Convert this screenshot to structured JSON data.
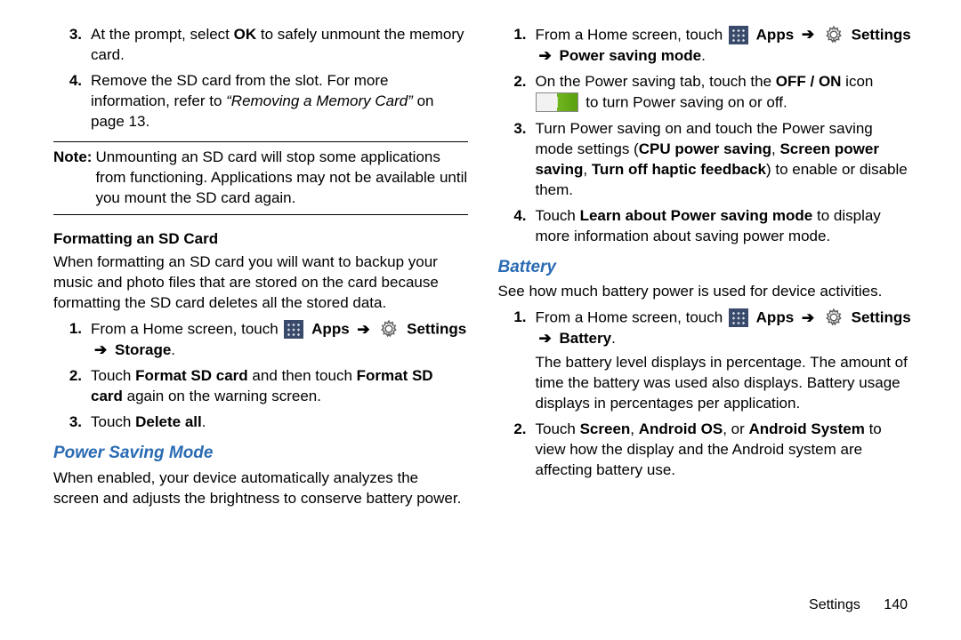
{
  "left": {
    "list1": [
      {
        "n": "3.",
        "html": "At the prompt, select <b>OK</b> to safely unmount the memory card."
      },
      {
        "n": "4.",
        "html": "Remove the SD card from the slot. For more information, refer to <i>“Removing a Memory Card”</i> on page 13."
      }
    ],
    "note_label": "Note:",
    "note_body": "Unmounting an SD card will stop some applications from functioning. Applications may not be available until you mount the SD card again.",
    "sub1": "Formatting an SD Card",
    "sub1_para": "When formatting an SD card you will want to backup your music and photo files that are stored on the card because formatting the SD card deletes all the stored data.",
    "list2": [
      {
        "n": "1.",
        "pre": "From a Home screen, touch ",
        "apps": "Apps",
        "settings": "Settings",
        "post": "Storage",
        "tail": "."
      },
      {
        "n": "2.",
        "html": "Touch <b>Format SD card</b> and then touch <b>Format SD card</b> again on the warning screen."
      },
      {
        "n": "3.",
        "html": "Touch <b>Delete all</b>."
      }
    ],
    "sec_head": "Power Saving Mode",
    "sec_para": "When enabled, your device automatically analyzes the screen and adjusts the brightness to conserve battery power."
  },
  "right": {
    "list1": [
      {
        "n": "1.",
        "pre": "From a Home screen, touch ",
        "apps": "Apps",
        "settings": "Settings",
        "post": "Power saving mode",
        "tail": "."
      },
      {
        "n": "2.",
        "pre2": "On the Power saving tab, touch the ",
        "bold2": "OFF / ON",
        "mid2": " icon ",
        "post2": " to turn Power saving on or off."
      },
      {
        "n": "3.",
        "html": "Turn Power saving on and touch the Power saving mode settings (<b>CPU power saving</b>, <b>Screen power saving</b>, <b>Turn off haptic feedback</b>) to enable or disable them."
      },
      {
        "n": "4.",
        "html": "Touch <b>Learn about Power saving mode</b> to display more information about saving power mode."
      }
    ],
    "sec_head": "Battery",
    "sec_para": "See how much battery power is used for device activities.",
    "list2": [
      {
        "n": "1.",
        "pre": "From a Home screen, touch ",
        "apps": "Apps",
        "settings": "Settings",
        "post": "Battery",
        "tail": ".",
        "extra": "The battery level displays in percentage. The amount of time the battery was used also displays. Battery usage displays in percentages per application."
      },
      {
        "n": "2.",
        "html": "Touch <b>Screen</b>, <b>Android OS</b>,  or <b>Android System</b> to view how the display and the Android system are affecting battery use."
      }
    ]
  },
  "arrow": "➔",
  "footer": {
    "section": "Settings",
    "page": "140"
  }
}
